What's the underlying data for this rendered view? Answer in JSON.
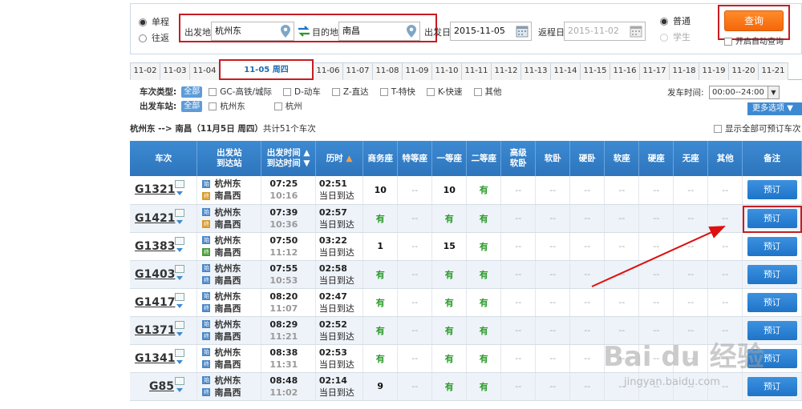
{
  "trip_types": {
    "oneway": "单程",
    "roundtrip": "往返"
  },
  "search": {
    "from_label": "出发地",
    "from_value": "杭州东",
    "to_label": "目的地",
    "to_value": "南昌",
    "depart_label": "出发日",
    "depart_value": "2015-11-05",
    "return_label": "返程日",
    "return_value": "2015-11-02",
    "type_normal": "普通",
    "type_student": "学生",
    "query_button": "查询",
    "auto_query": "开启自动查询"
  },
  "date_tabs": [
    "11-02",
    "11-03",
    "11-04",
    "11-05 周四",
    "11-06",
    "11-07",
    "11-08",
    "11-09",
    "11-10",
    "11-11",
    "11-12",
    "11-13",
    "11-14",
    "11-15",
    "11-16",
    "11-17",
    "11-18",
    "11-19",
    "11-20",
    "11-21"
  ],
  "filters": {
    "train_type_label": "车次类型:",
    "all": "全部",
    "train_types": [
      "GC-高铁/城际",
      "D-动车",
      "Z-直达",
      "T-特快",
      "K-快速",
      "其他"
    ],
    "station_label": "出发车站:",
    "stations": [
      "杭州东",
      "杭州"
    ],
    "dep_time_label": "发车时间:",
    "dep_time_value": "00:00--24:00",
    "more_options": "更多选项"
  },
  "route_info": {
    "route": "杭州东 --> 南昌（11月5日  周四）",
    "count": "共计51个车次"
  },
  "show_all": "显示全部可预订车次",
  "columns": {
    "train": "车次",
    "stations_1": "出发站",
    "stations_2": "到达站",
    "time_1": "出发时间",
    "time_2": "到达时间",
    "duration": "历时",
    "business": "商务座",
    "special": "特等座",
    "first": "一等座",
    "second": "二等座",
    "soft_sleeper_hi_1": "高级",
    "soft_sleeper_hi_2": "软卧",
    "soft_sleeper": "软卧",
    "hard_sleeper": "硬卧",
    "soft_seat": "软座",
    "hard_seat": "硬座",
    "no_seat": "无座",
    "other": "其他",
    "remark": "备注"
  },
  "book_label": "预订",
  "rows": [
    {
      "code": "G1321",
      "from": "杭州东",
      "to": "南昌西",
      "dep": "07:25",
      "arr": "10:16",
      "dur": "02:51",
      "dur2": "当日到达",
      "biz": "10",
      "spe": "--",
      "fst": "10",
      "snd": "有"
    },
    {
      "code": "G1421",
      "from": "杭州东",
      "to": "南昌西",
      "dep": "07:39",
      "arr": "10:36",
      "dur": "02:57",
      "dur2": "当日到达",
      "biz": "有",
      "spe": "--",
      "fst": "有",
      "snd": "有"
    },
    {
      "code": "G1383",
      "from": "杭州东",
      "to": "南昌西",
      "dep": "07:50",
      "arr": "11:12",
      "dur": "03:22",
      "dur2": "当日到达",
      "biz": "1",
      "spe": "--",
      "fst": "15",
      "snd": "有"
    },
    {
      "code": "G1403",
      "from": "杭州东",
      "to": "南昌西",
      "dep": "07:55",
      "arr": "10:53",
      "dur": "02:58",
      "dur2": "当日到达",
      "biz": "有",
      "spe": "--",
      "fst": "有",
      "snd": "有"
    },
    {
      "code": "G1417",
      "from": "杭州东",
      "to": "南昌西",
      "dep": "08:20",
      "arr": "11:07",
      "dur": "02:47",
      "dur2": "当日到达",
      "biz": "有",
      "spe": "--",
      "fst": "有",
      "snd": "有"
    },
    {
      "code": "G1371",
      "from": "杭州东",
      "to": "南昌西",
      "dep": "08:29",
      "arr": "11:21",
      "dur": "02:52",
      "dur2": "当日到达",
      "biz": "有",
      "spe": "--",
      "fst": "有",
      "snd": "有"
    },
    {
      "code": "G1341",
      "from": "杭州东",
      "to": "南昌西",
      "dep": "08:38",
      "arr": "11:31",
      "dur": "02:53",
      "dur2": "当日到达",
      "biz": "有",
      "spe": "--",
      "fst": "有",
      "snd": "有"
    },
    {
      "code": "G85",
      "from": "杭州东",
      "to": "南昌西",
      "dep": "08:48",
      "arr": "11:02",
      "dur": "02:14",
      "dur2": "当日到达",
      "biz": "9",
      "spe": "--",
      "fst": "有",
      "snd": "有"
    }
  ],
  "dash": "--",
  "watermark": {
    "main": "Bai du 经验",
    "url": "jingyan.baidu.com"
  }
}
